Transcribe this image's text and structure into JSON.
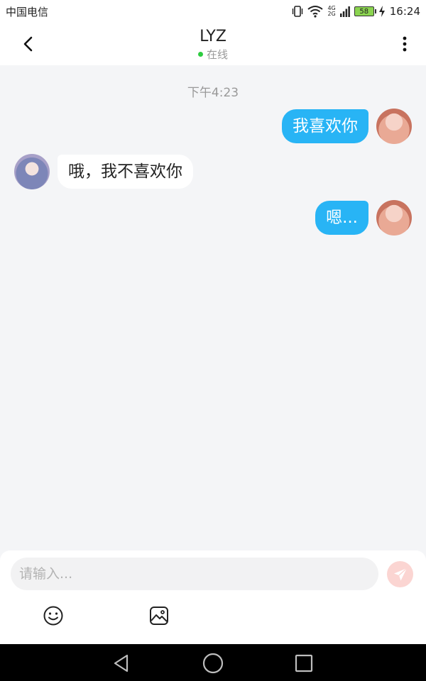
{
  "status_bar": {
    "carrier": "中国电信",
    "network_top": "4G",
    "network_bottom": "2G",
    "battery_level": "58",
    "time": "16:24",
    "icons": [
      "vibrate-icon",
      "wifi-icon",
      "signal-icon",
      "battery-icon",
      "charging-icon"
    ]
  },
  "header": {
    "contact_name": "LYZ",
    "status_text": "在线",
    "status_color": "#2ecc40",
    "back_icon": "chevron-left-icon",
    "more_icon": "more-vertical-icon"
  },
  "conversation": {
    "timestamp": "下午4:23",
    "messages": [
      {
        "sender": "self",
        "text": "我喜欢你"
      },
      {
        "sender": "other",
        "text": "哦，我不喜欢你"
      },
      {
        "sender": "self",
        "text": "嗯..."
      }
    ]
  },
  "composer": {
    "placeholder": "请输入...",
    "value": "",
    "send_icon": "send-icon",
    "tools": [
      "emoji-icon",
      "image-icon"
    ]
  },
  "colors": {
    "sent_bubble": "#28b4f5",
    "received_bubble": "#ffffff",
    "background": "#f4f5f7",
    "send_button": "#fbd5d2"
  },
  "nav_bar": {
    "icons": [
      "back-triangle-icon",
      "home-circle-icon",
      "recents-square-icon"
    ]
  }
}
